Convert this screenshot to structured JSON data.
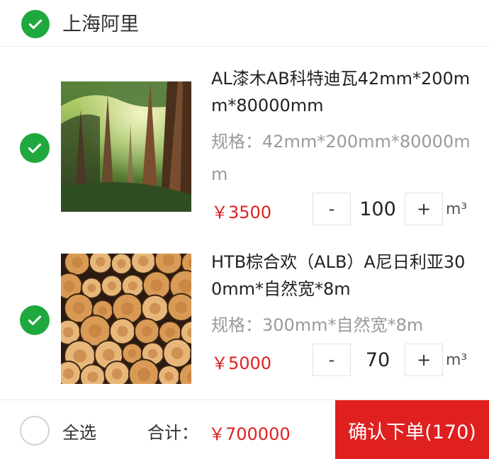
{
  "store": {
    "name": "上海阿里",
    "checked": true
  },
  "items": [
    {
      "title": "AL漆木AB科特迪瓦42mm*200mm*80000mm",
      "spec": "规格：42mm*200mm*80000mm",
      "price": "￥3500",
      "minus": "-",
      "qty": "100",
      "plus": "+",
      "unit": "m³",
      "image": "redwood-forest",
      "checked": true
    },
    {
      "title": "HTB棕合欢（ALB）A尼日利亚300mm*自然宽*8m",
      "spec": "规格：300mm*自然宽*8m",
      "price": "￥5000",
      "minus": "-",
      "qty": "70",
      "plus": "+",
      "unit": "m³",
      "image": "log-pile",
      "checked": true
    }
  ],
  "footer": {
    "select_all": "全选",
    "total_label": "合计：",
    "total_value": "￥700000",
    "confirm": "确认下单(170)"
  },
  "colors": {
    "check": "#1fa83d",
    "price": "#e02020",
    "confirm_bg": "#e01f1f"
  },
  "icons": {
    "check": "checkmark-icon"
  }
}
